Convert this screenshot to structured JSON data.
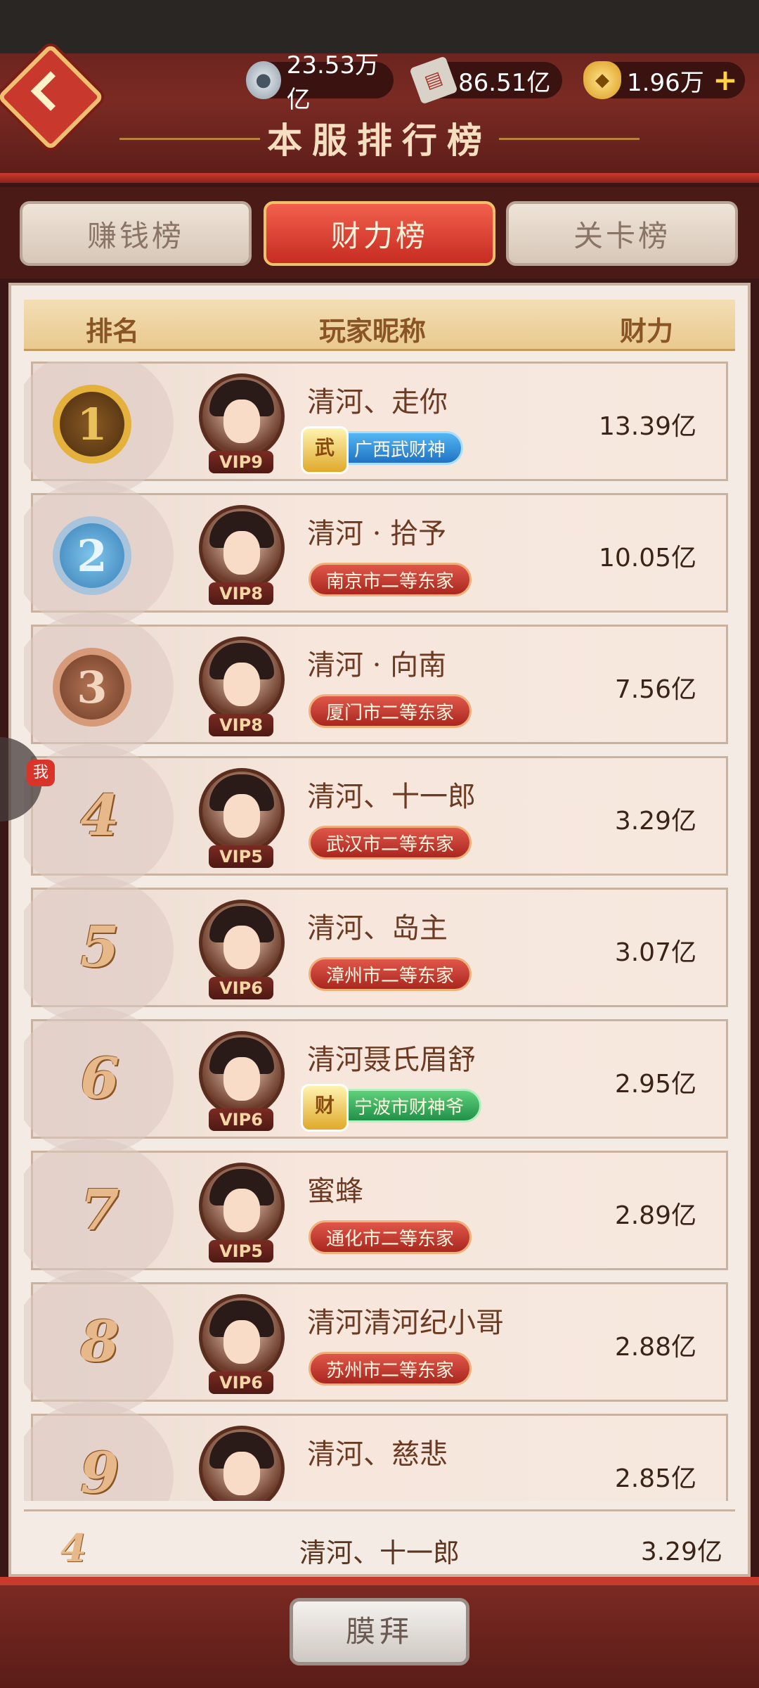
{
  "header": {
    "title": "本服排行榜",
    "resources": {
      "silver": "23.53万亿",
      "ticket": "86.51亿",
      "gold": "1.96万"
    }
  },
  "tabs": [
    {
      "label": "赚钱榜",
      "active": false
    },
    {
      "label": "财力榜",
      "active": true
    },
    {
      "label": "关卡榜",
      "active": false
    }
  ],
  "columns": {
    "rank": "排名",
    "name": "玩家昵称",
    "wealth": "财力"
  },
  "rows": [
    {
      "rank": "1",
      "vip": "VIP9",
      "name": "清河、走你",
      "badge": "广西武财神",
      "badge_style": "blue",
      "emblem": "武",
      "wealth": "13.39亿"
    },
    {
      "rank": "2",
      "vip": "VIP8",
      "name": "清河 · 拾予",
      "badge": "南京市二等东家",
      "badge_style": "red",
      "wealth": "10.05亿"
    },
    {
      "rank": "3",
      "vip": "VIP8",
      "name": "清河 · 向南",
      "badge": "厦门市二等东家",
      "badge_style": "red",
      "wealth": "7.56亿"
    },
    {
      "rank": "4",
      "vip": "VIP5",
      "name": "清河、十一郎",
      "badge": "武汉市二等东家",
      "badge_style": "red",
      "wealth": "3.29亿"
    },
    {
      "rank": "5",
      "vip": "VIP6",
      "name": "清河、岛主",
      "badge": "漳州市二等东家",
      "badge_style": "red",
      "wealth": "3.07亿"
    },
    {
      "rank": "6",
      "vip": "VIP6",
      "name": "清河聂氏眉舒",
      "badge": "宁波市财神爷",
      "badge_style": "green",
      "emblem": "财",
      "wealth": "2.95亿"
    },
    {
      "rank": "7",
      "vip": "VIP5",
      "name": "蜜蜂",
      "badge": "通化市二等东家",
      "badge_style": "red",
      "wealth": "2.89亿"
    },
    {
      "rank": "8",
      "vip": "VIP6",
      "name": "清河清河纪小哥",
      "badge": "苏州市二等东家",
      "badge_style": "red",
      "wealth": "2.88亿"
    },
    {
      "rank": "9",
      "vip": "",
      "name": "清河、慈悲",
      "badge": "",
      "badge_style": "red",
      "wealth": "2.85亿"
    }
  ],
  "my_rank": {
    "rank": "4",
    "name": "清河、十一郎",
    "wealth": "3.29亿"
  },
  "floater_tag": "我",
  "worship_button": "膜拜",
  "colors": {
    "accent_red": "#c83a2c",
    "gold": "#e3b13c"
  }
}
